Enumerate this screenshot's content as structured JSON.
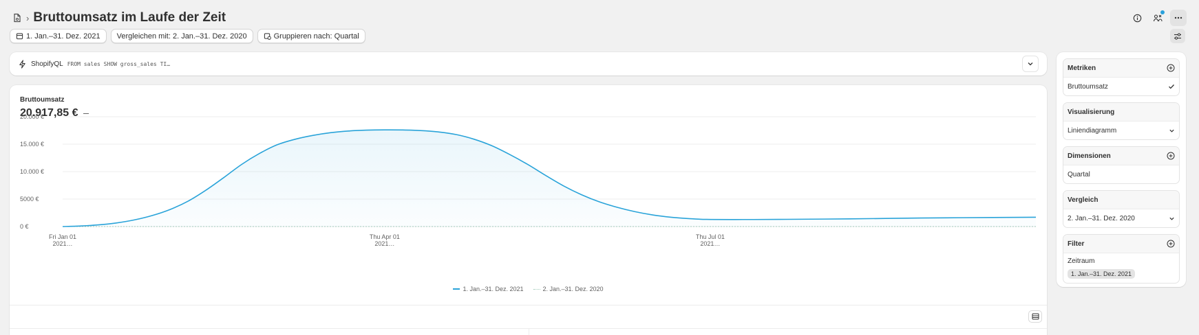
{
  "header": {
    "title": "Bruttoumsatz im Laufe der Zeit",
    "breadcrumb_separator": "›"
  },
  "toolbar": {
    "date_range": "1. Jan.–31. Dez. 2021",
    "compare": "Vergleichen mit: 2. Jan.–31. Dez. 2020",
    "group_by": "Gruppieren nach: Quartal"
  },
  "query": {
    "label": "ShopifyQL",
    "code": "FROM sales SHOW gross_sales TI…"
  },
  "metric": {
    "name": "Bruttoumsatz",
    "value": "20.917,85 €",
    "change": "—"
  },
  "legend": {
    "current": "1. Jan.–31. Dez. 2021",
    "previous": "2. Jan.–31. Dez. 2020"
  },
  "sidebar": {
    "metrics": {
      "title": "Metriken",
      "item": "Bruttoumsatz"
    },
    "visualization": {
      "title": "Visualisierung",
      "value": "Liniendiagramm"
    },
    "dimensions": {
      "title": "Dimensionen",
      "item": "Quartal"
    },
    "comparison": {
      "title": "Vergleich",
      "value": "2. Jan.–31. Dez. 2020"
    },
    "filter": {
      "title": "Filter",
      "label": "Zeitraum",
      "tag": "1. Jan.–31. Dez. 2021"
    }
  },
  "colors": {
    "primary_line": "#29a3d9",
    "comparison_line": "#9fc9b9",
    "accent_dot": "#2aa1dc"
  },
  "chart_data": {
    "type": "area",
    "title": "Bruttoumsatz",
    "xlabel": "",
    "ylabel": "",
    "ylim": [
      0,
      20000
    ],
    "y_ticks": [
      "20.000 €",
      "15.000 €",
      "10.000 €",
      "5000 €",
      "0 €"
    ],
    "y_tick_values": [
      20000,
      15000,
      10000,
      5000,
      0
    ],
    "x_ticks": [
      {
        "line1": "Fri Jan 01",
        "line2": "2021…",
        "day": 0
      },
      {
        "line1": "Thu Apr 01",
        "line2": "2021…",
        "day": 90
      },
      {
        "line1": "Thu Jul 01",
        "line2": "2021…",
        "day": 181
      }
    ],
    "x_domain_days": [
      0,
      272
    ],
    "grid": true,
    "legend_position": "bottom-center",
    "series": [
      {
        "name": "1. Jan.–31. Dez. 2021",
        "x": [
          0,
          5,
          10,
          15,
          20,
          25,
          30,
          35,
          40,
          45,
          50,
          55,
          60,
          65,
          70,
          75,
          80,
          85,
          90,
          95,
          100,
          105,
          110,
          115,
          120,
          125,
          130,
          135,
          140,
          145,
          150,
          155,
          160,
          165,
          170,
          175,
          180,
          190,
          200,
          220,
          240,
          260,
          272
        ],
        "y": [
          0,
          100,
          300,
          650,
          1200,
          2000,
          3100,
          4600,
          6600,
          8900,
          11300,
          13300,
          14900,
          15900,
          16600,
          17100,
          17400,
          17550,
          17600,
          17580,
          17480,
          17230,
          16750,
          15900,
          14700,
          13100,
          11300,
          9300,
          7400,
          5800,
          4500,
          3500,
          2700,
          2100,
          1700,
          1450,
          1300,
          1280,
          1300,
          1400,
          1550,
          1650,
          1700
        ]
      },
      {
        "name": "2. Jan.–31. Dez. 2020",
        "x": [
          0,
          272
        ],
        "y": [
          0,
          0
        ]
      }
    ]
  }
}
